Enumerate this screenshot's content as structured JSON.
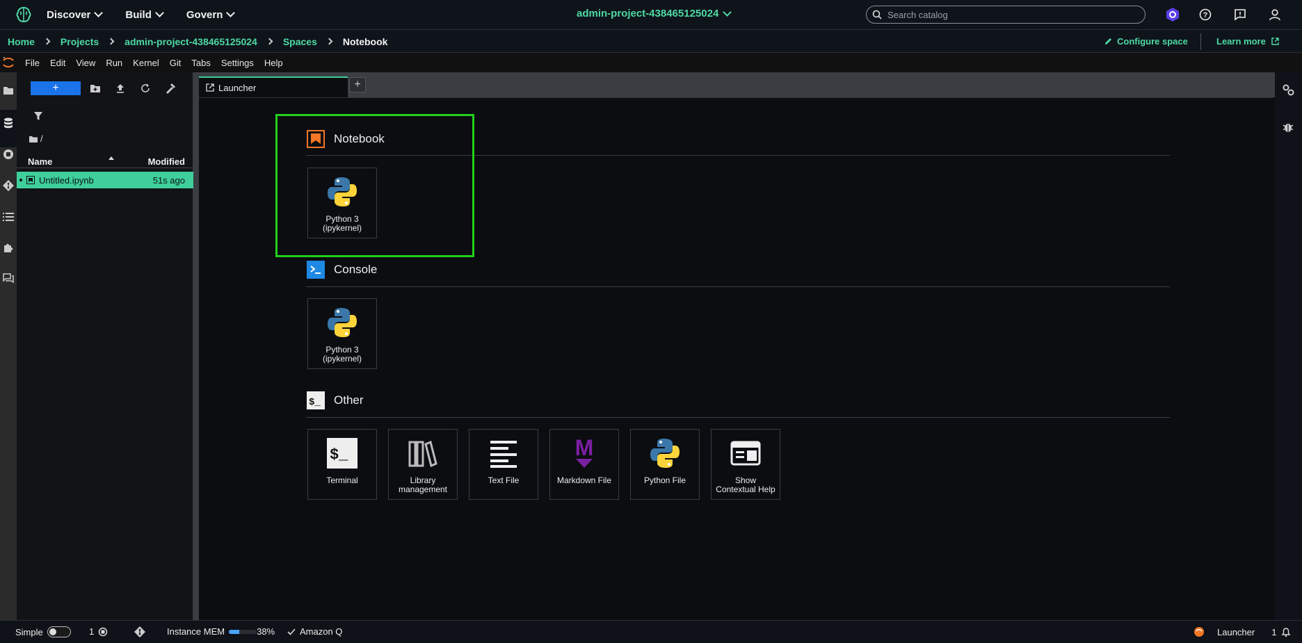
{
  "topnav": {
    "items": [
      {
        "label": "Discover"
      },
      {
        "label": "Build"
      },
      {
        "label": "Govern"
      }
    ],
    "project": "admin-project-438465125024",
    "search_placeholder": "Search catalog"
  },
  "breadcrumb": {
    "items": [
      "Home",
      "Projects",
      "admin-project-438465125024",
      "Spaces"
    ],
    "current": "Notebook",
    "configure": "Configure space",
    "learn_more": "Learn more"
  },
  "menubar": {
    "items": [
      "File",
      "Edit",
      "View",
      "Run",
      "Kernel",
      "Git",
      "Tabs",
      "Settings",
      "Help"
    ]
  },
  "filebrowser": {
    "new_label": "+",
    "path": "/",
    "col_name": "Name",
    "col_modified": "Modified",
    "files": [
      {
        "name": "Untitled.ipynb",
        "modified": "51s ago"
      }
    ]
  },
  "tabs": {
    "active": "Launcher",
    "add": "+"
  },
  "launcher": {
    "notebook": {
      "title": "Notebook",
      "cards": [
        {
          "label_1": "Python 3",
          "label_2": "(ipykernel)"
        }
      ]
    },
    "console": {
      "title": "Console",
      "cards": [
        {
          "label_1": "Python 3",
          "label_2": "(ipykernel)"
        }
      ]
    },
    "other": {
      "title": "Other",
      "cards": [
        {
          "label_1": "Terminal",
          "label_2": ""
        },
        {
          "label_1": "Library",
          "label_2": "management"
        },
        {
          "label_1": "Text File",
          "label_2": ""
        },
        {
          "label_1": "Markdown File",
          "label_2": ""
        },
        {
          "label_1": "Python File",
          "label_2": ""
        },
        {
          "label_1": "Show",
          "label_2": "Contextual Help"
        }
      ]
    }
  },
  "statusbar": {
    "simple": "Simple",
    "terminals": "1",
    "mem_label": "Instance MEM",
    "mem_percent": "38%",
    "mem_fraction": 0.38,
    "amazon_q": "Amazon Q",
    "launcher": "Launcher",
    "notif_count": "1"
  },
  "colors": {
    "accent": "#4ed9a3",
    "selection": "#3ecf9a",
    "highlight_box": "#22d01a",
    "primary_button": "#1a73e8"
  }
}
